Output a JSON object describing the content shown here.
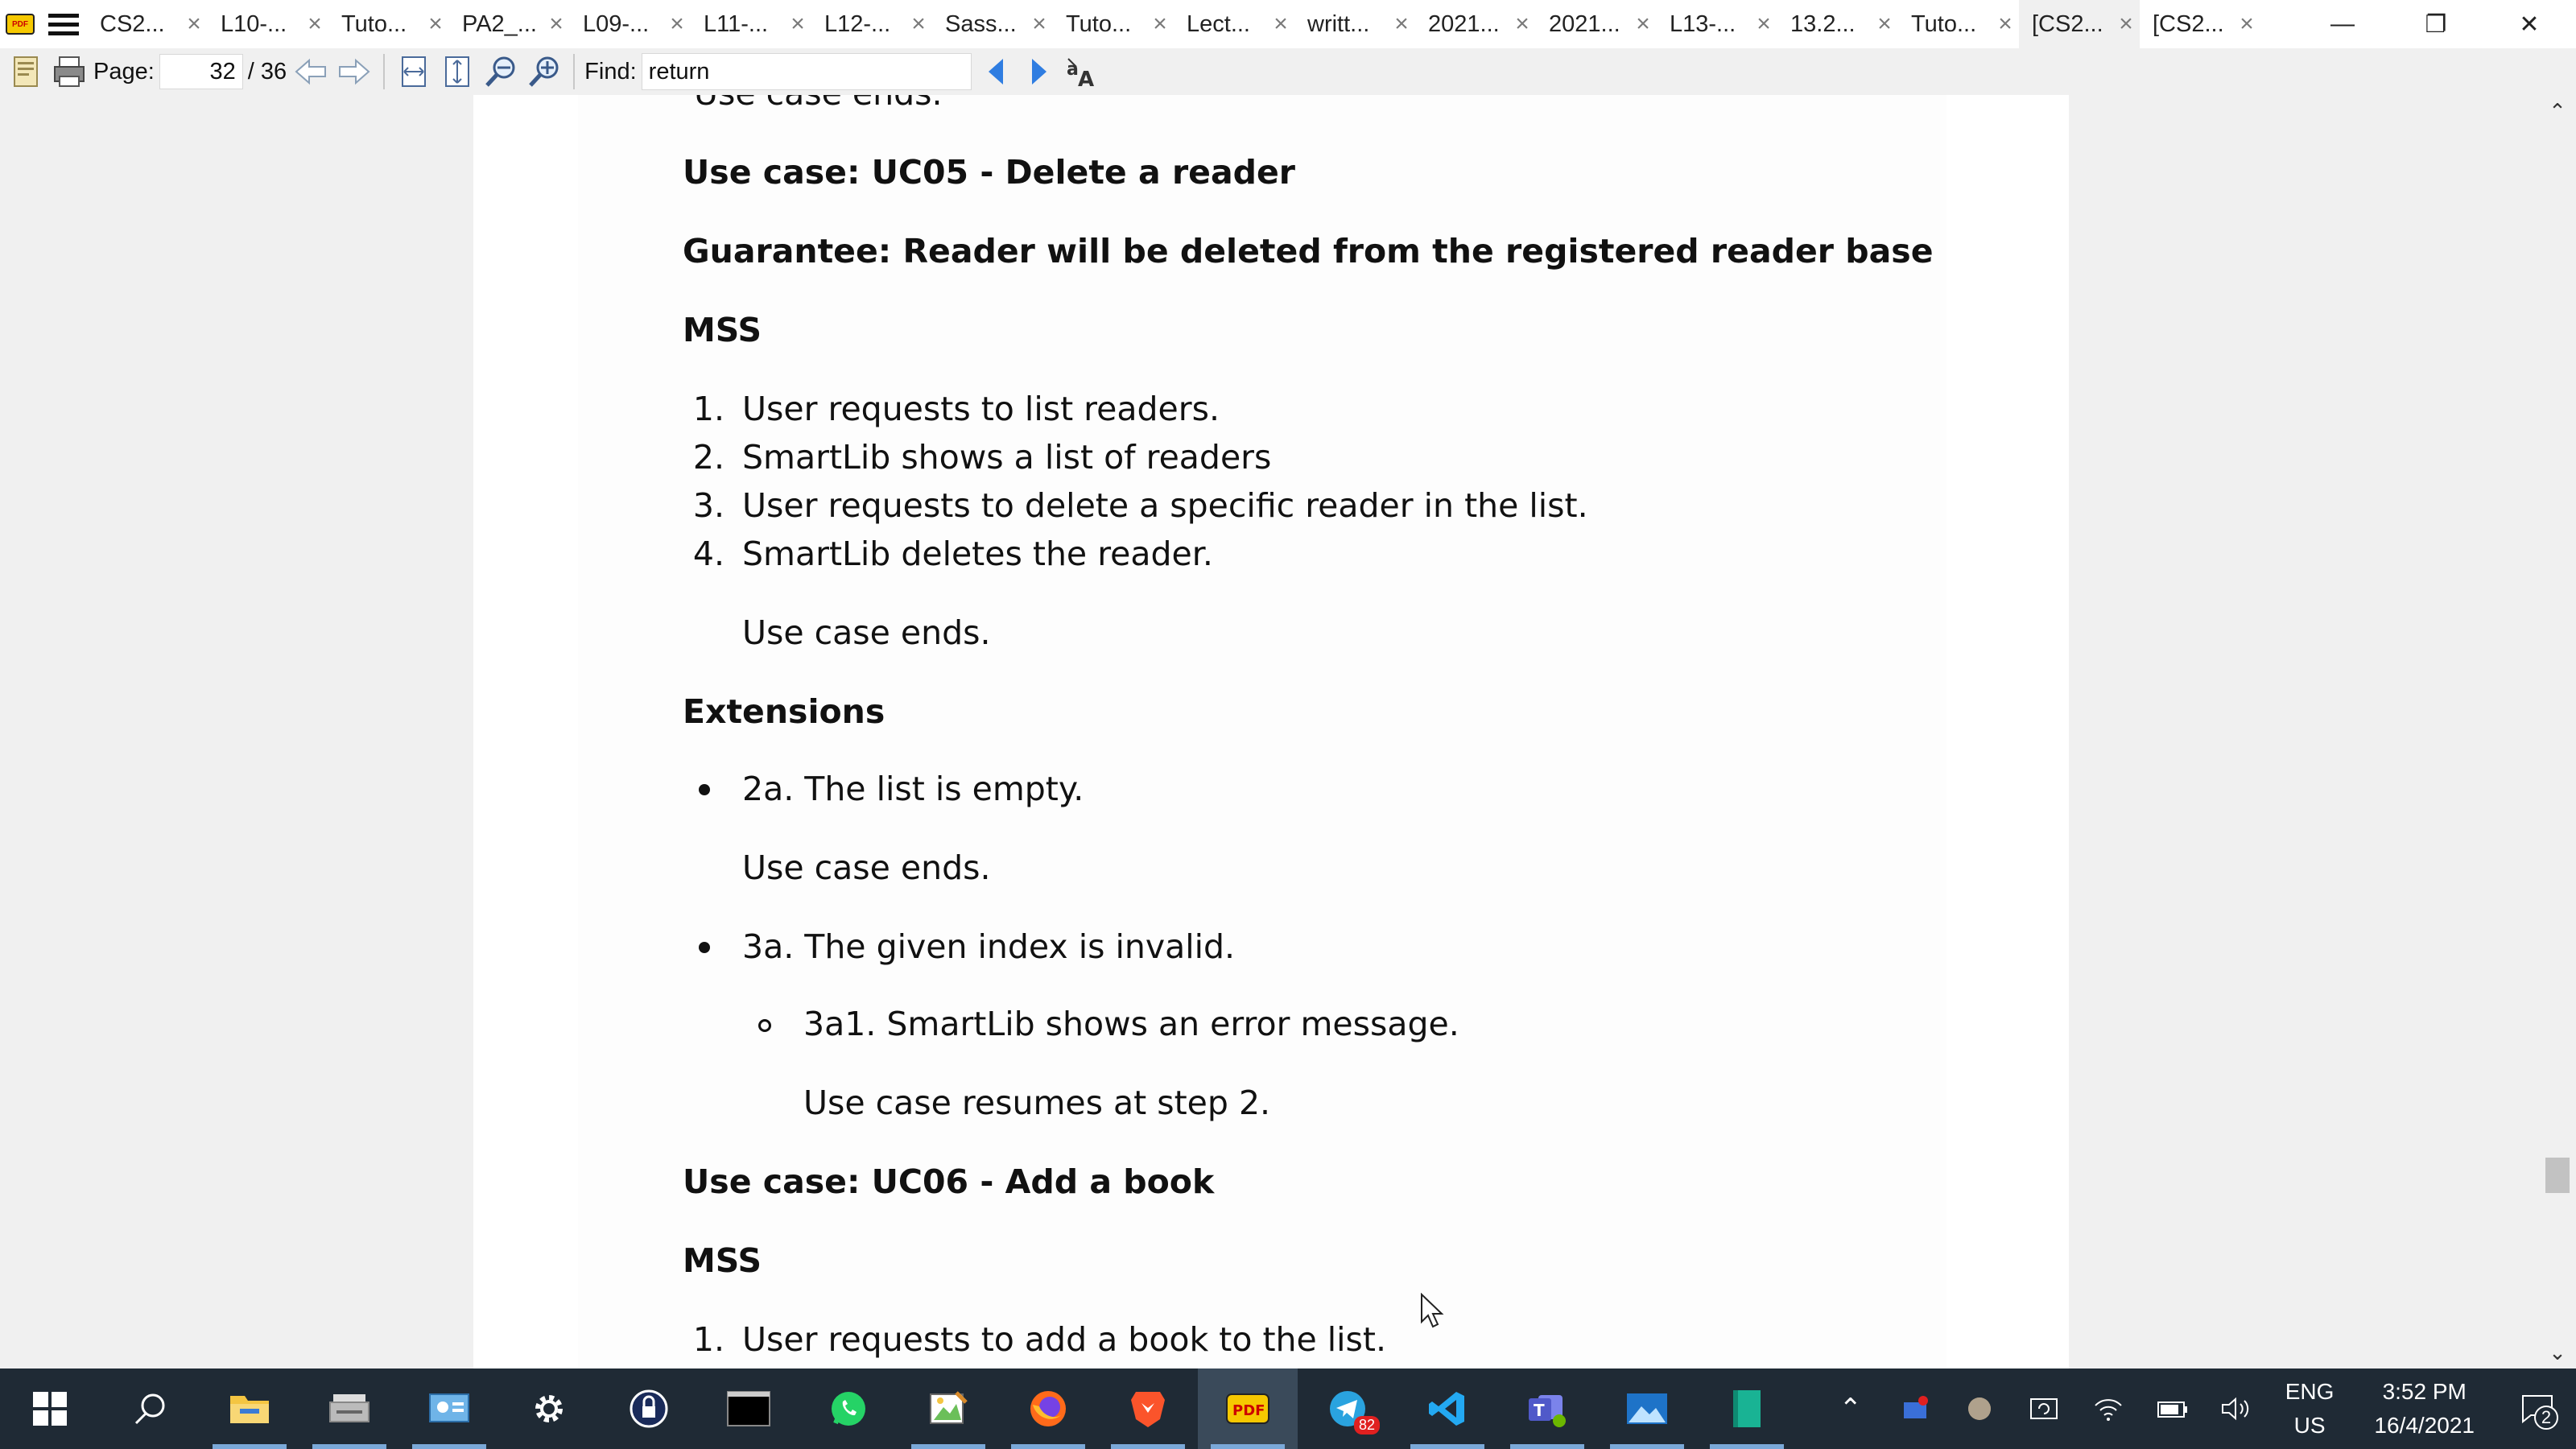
{
  "tabs": [
    {
      "label": "CS2..."
    },
    {
      "label": "L10-..."
    },
    {
      "label": "Tuto..."
    },
    {
      "label": "PA2_..."
    },
    {
      "label": "L09-..."
    },
    {
      "label": "L11-..."
    },
    {
      "label": "L12-..."
    },
    {
      "label": "Sass..."
    },
    {
      "label": "Tuto..."
    },
    {
      "label": "Lect..."
    },
    {
      "label": "writt..."
    },
    {
      "label": "2021..."
    },
    {
      "label": "2021..."
    },
    {
      "label": "L13-..."
    },
    {
      "label": "13.2..."
    },
    {
      "label": "Tuto..."
    },
    {
      "label": "[CS2..."
    },
    {
      "label": "[CS2..."
    }
  ],
  "toolbar": {
    "page_label": "Page:",
    "page_value": "32",
    "page_total": "/ 36",
    "find_label": "Find:",
    "find_value": "return"
  },
  "document": {
    "top_partial": "Use case ends.",
    "uc05_title": "Use case: UC05 - Delete a reader",
    "guarantee": "Guarantee: Reader will be deleted from the registered reader base",
    "mss_heading": "MSS",
    "mss_steps": [
      {
        "num": "1.",
        "text": "User requests to list readers."
      },
      {
        "num": "2.",
        "text": "SmartLib shows a list of readers"
      },
      {
        "num": "3.",
        "text": "User requests to delete a specific reader in the list."
      },
      {
        "num": "4.",
        "text": "SmartLib deletes the reader."
      }
    ],
    "mss_end": "Use case ends.",
    "extensions_heading": "Extensions",
    "ext_2a": "2a. The list is empty.",
    "ext_2a_end": "Use case ends.",
    "ext_3a": "3a. The given index is invalid.",
    "ext_3a1": "3a1. SmartLib shows an error message.",
    "ext_3a1_end": "Use case resumes at step 2.",
    "uc06_title": "Use case: UC06 - Add a book",
    "uc06_mss": "MSS",
    "uc06_step1": {
      "num": "1.",
      "text": "User requests to add a book to the list."
    }
  },
  "taskbar": {
    "apps": [
      "start-icon",
      "search-icon",
      "file-explorer-icon",
      "scanner-icon",
      "control-panel-icon",
      "settings-icon",
      "vpn-icon",
      "terminal-icon",
      "whatsapp-icon",
      "paint-icon",
      "firefox-icon",
      "brave-icon",
      "pdf-reader-icon",
      "telegram-icon",
      "vscode-icon",
      "teams-icon",
      "photos-icon",
      "book-icon"
    ],
    "telegram_badge": "82",
    "lang_line1": "ENG",
    "lang_line2": "US",
    "time": "3:52 PM",
    "date": "16/4/2021",
    "notification_count": "2"
  }
}
